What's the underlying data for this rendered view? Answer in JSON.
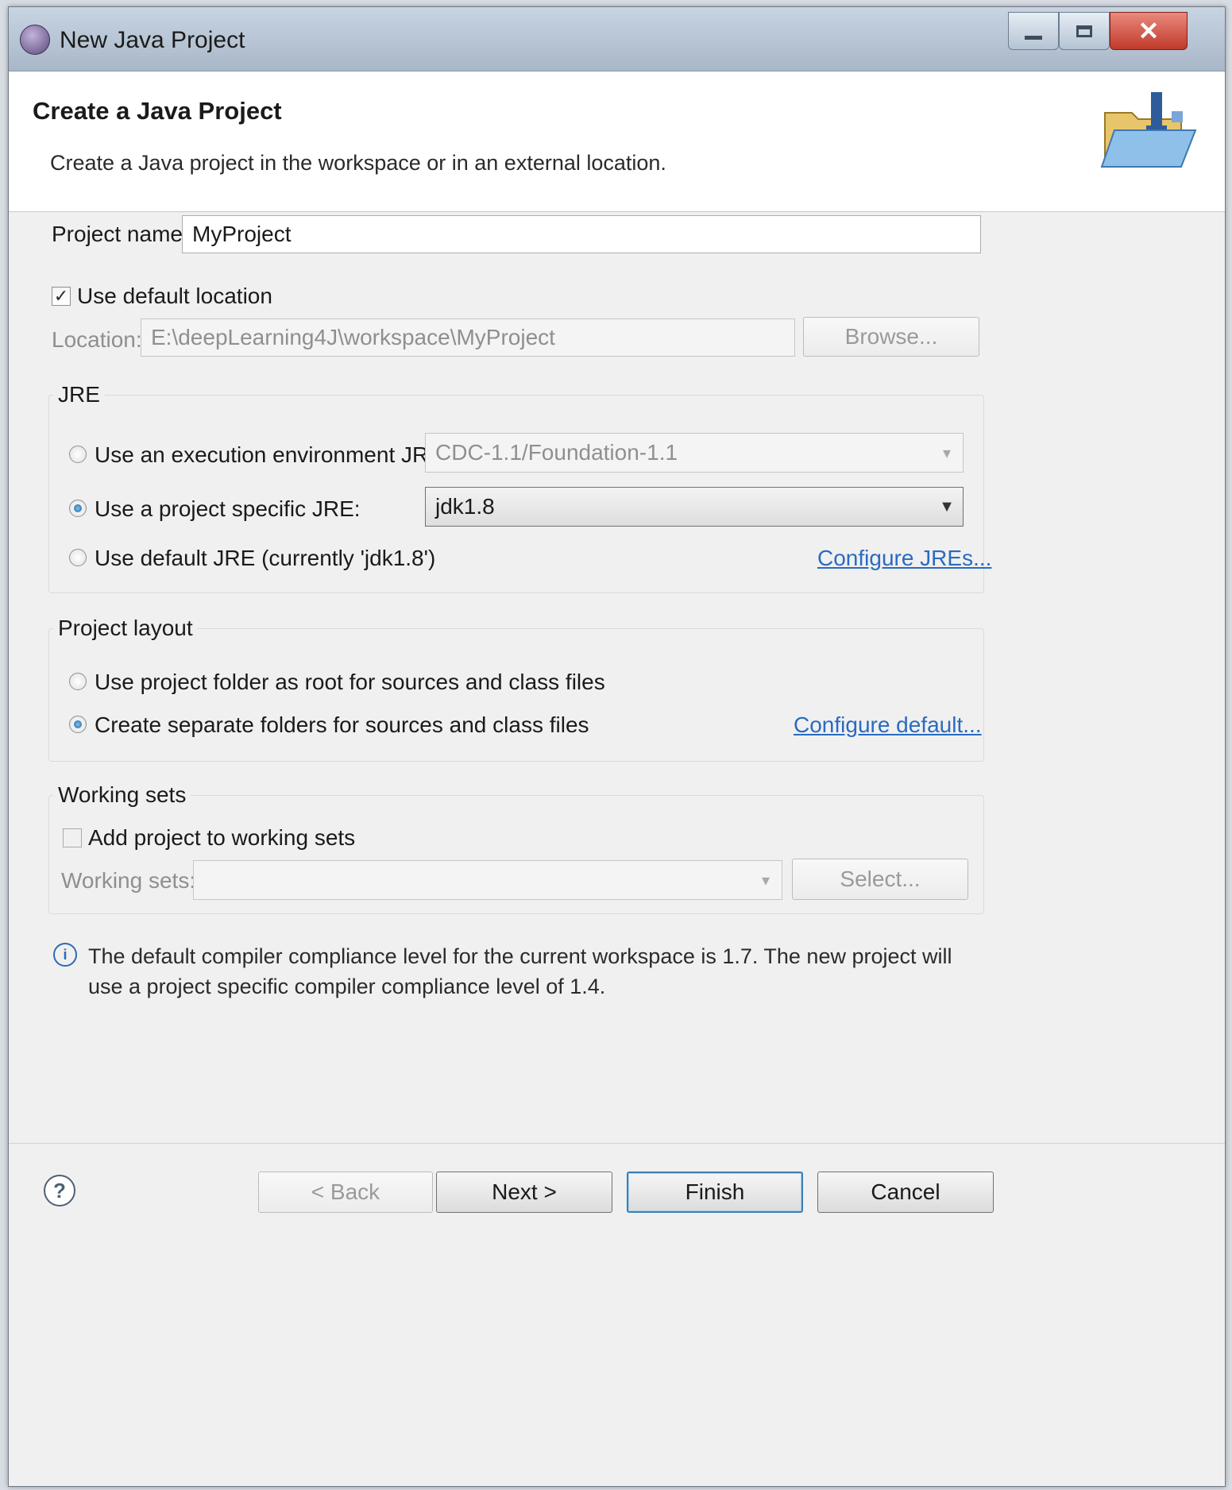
{
  "window": {
    "title": "New Java Project",
    "icon": "eclipse-icon"
  },
  "header": {
    "title": "Create a Java Project",
    "description": "Create a Java project in the workspace or in an external location.",
    "icon": "java-project-folder-icon"
  },
  "project": {
    "name_label": "Project name:",
    "name_value": "MyProject",
    "use_default_location_label": "Use default location",
    "use_default_location_checked": true,
    "location_label": "Location:",
    "location_value": "E:\\deepLearning4J\\workspace\\MyProject",
    "browse_label": "Browse..."
  },
  "jre": {
    "group_label": "JRE",
    "options": [
      {
        "label": "Use an execution environment JRE:",
        "selected": false
      },
      {
        "label": "Use a project specific JRE:",
        "selected": true
      },
      {
        "label": "Use default JRE (currently 'jdk1.8')",
        "selected": false
      }
    ],
    "execution_env_value": "CDC-1.1/Foundation-1.1",
    "project_jre_value": "jdk1.8",
    "configure_link": "Configure JREs..."
  },
  "layout": {
    "group_label": "Project layout",
    "options": [
      {
        "label": "Use project folder as root for sources and class files",
        "selected": false
      },
      {
        "label": "Create separate folders for sources and class files",
        "selected": true
      }
    ],
    "configure_link": "Configure default..."
  },
  "working_sets": {
    "group_label": "Working sets",
    "add_label": "Add project to working sets",
    "add_checked": false,
    "sets_label": "Working sets:",
    "sets_value": "",
    "select_label": "Select..."
  },
  "info": {
    "message": "The default compiler compliance level for the current workspace is 1.7. The new project will use a project specific compiler compliance level of 1.4."
  },
  "buttons": {
    "back": "< Back",
    "next": "Next >",
    "finish": "Finish",
    "cancel": "Cancel"
  }
}
